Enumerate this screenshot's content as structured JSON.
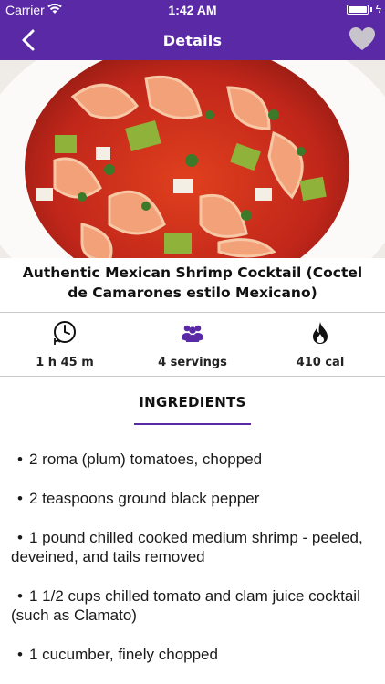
{
  "status_bar": {
    "carrier": "Carrier",
    "time": "1:42 AM"
  },
  "nav": {
    "title": "Details",
    "back_icon": "chevron-left-icon",
    "favorite_icon": "heart-icon"
  },
  "recipe": {
    "title": "Authentic Mexican Shrimp Cocktail (Coctel de Camarones estilo Mexicano)",
    "stats": {
      "time": "1 h 45 m",
      "servings": "4 servings",
      "calories": "410 cal"
    }
  },
  "ingredients": {
    "heading": "INGREDIENTS",
    "items": [
      "2 roma (plum) tomatoes, chopped",
      "2 teaspoons ground black pepper",
      "1 pound chilled cooked medium shrimp - peeled, deveined, and tails removed",
      "1 1/2 cups chilled tomato and clam juice cocktail (such as Clamato)",
      "1 cucumber, finely chopped"
    ]
  },
  "colors": {
    "brand": "#5a2aa6",
    "text": "#1a1a1a",
    "divider": "#c9c9c9"
  }
}
